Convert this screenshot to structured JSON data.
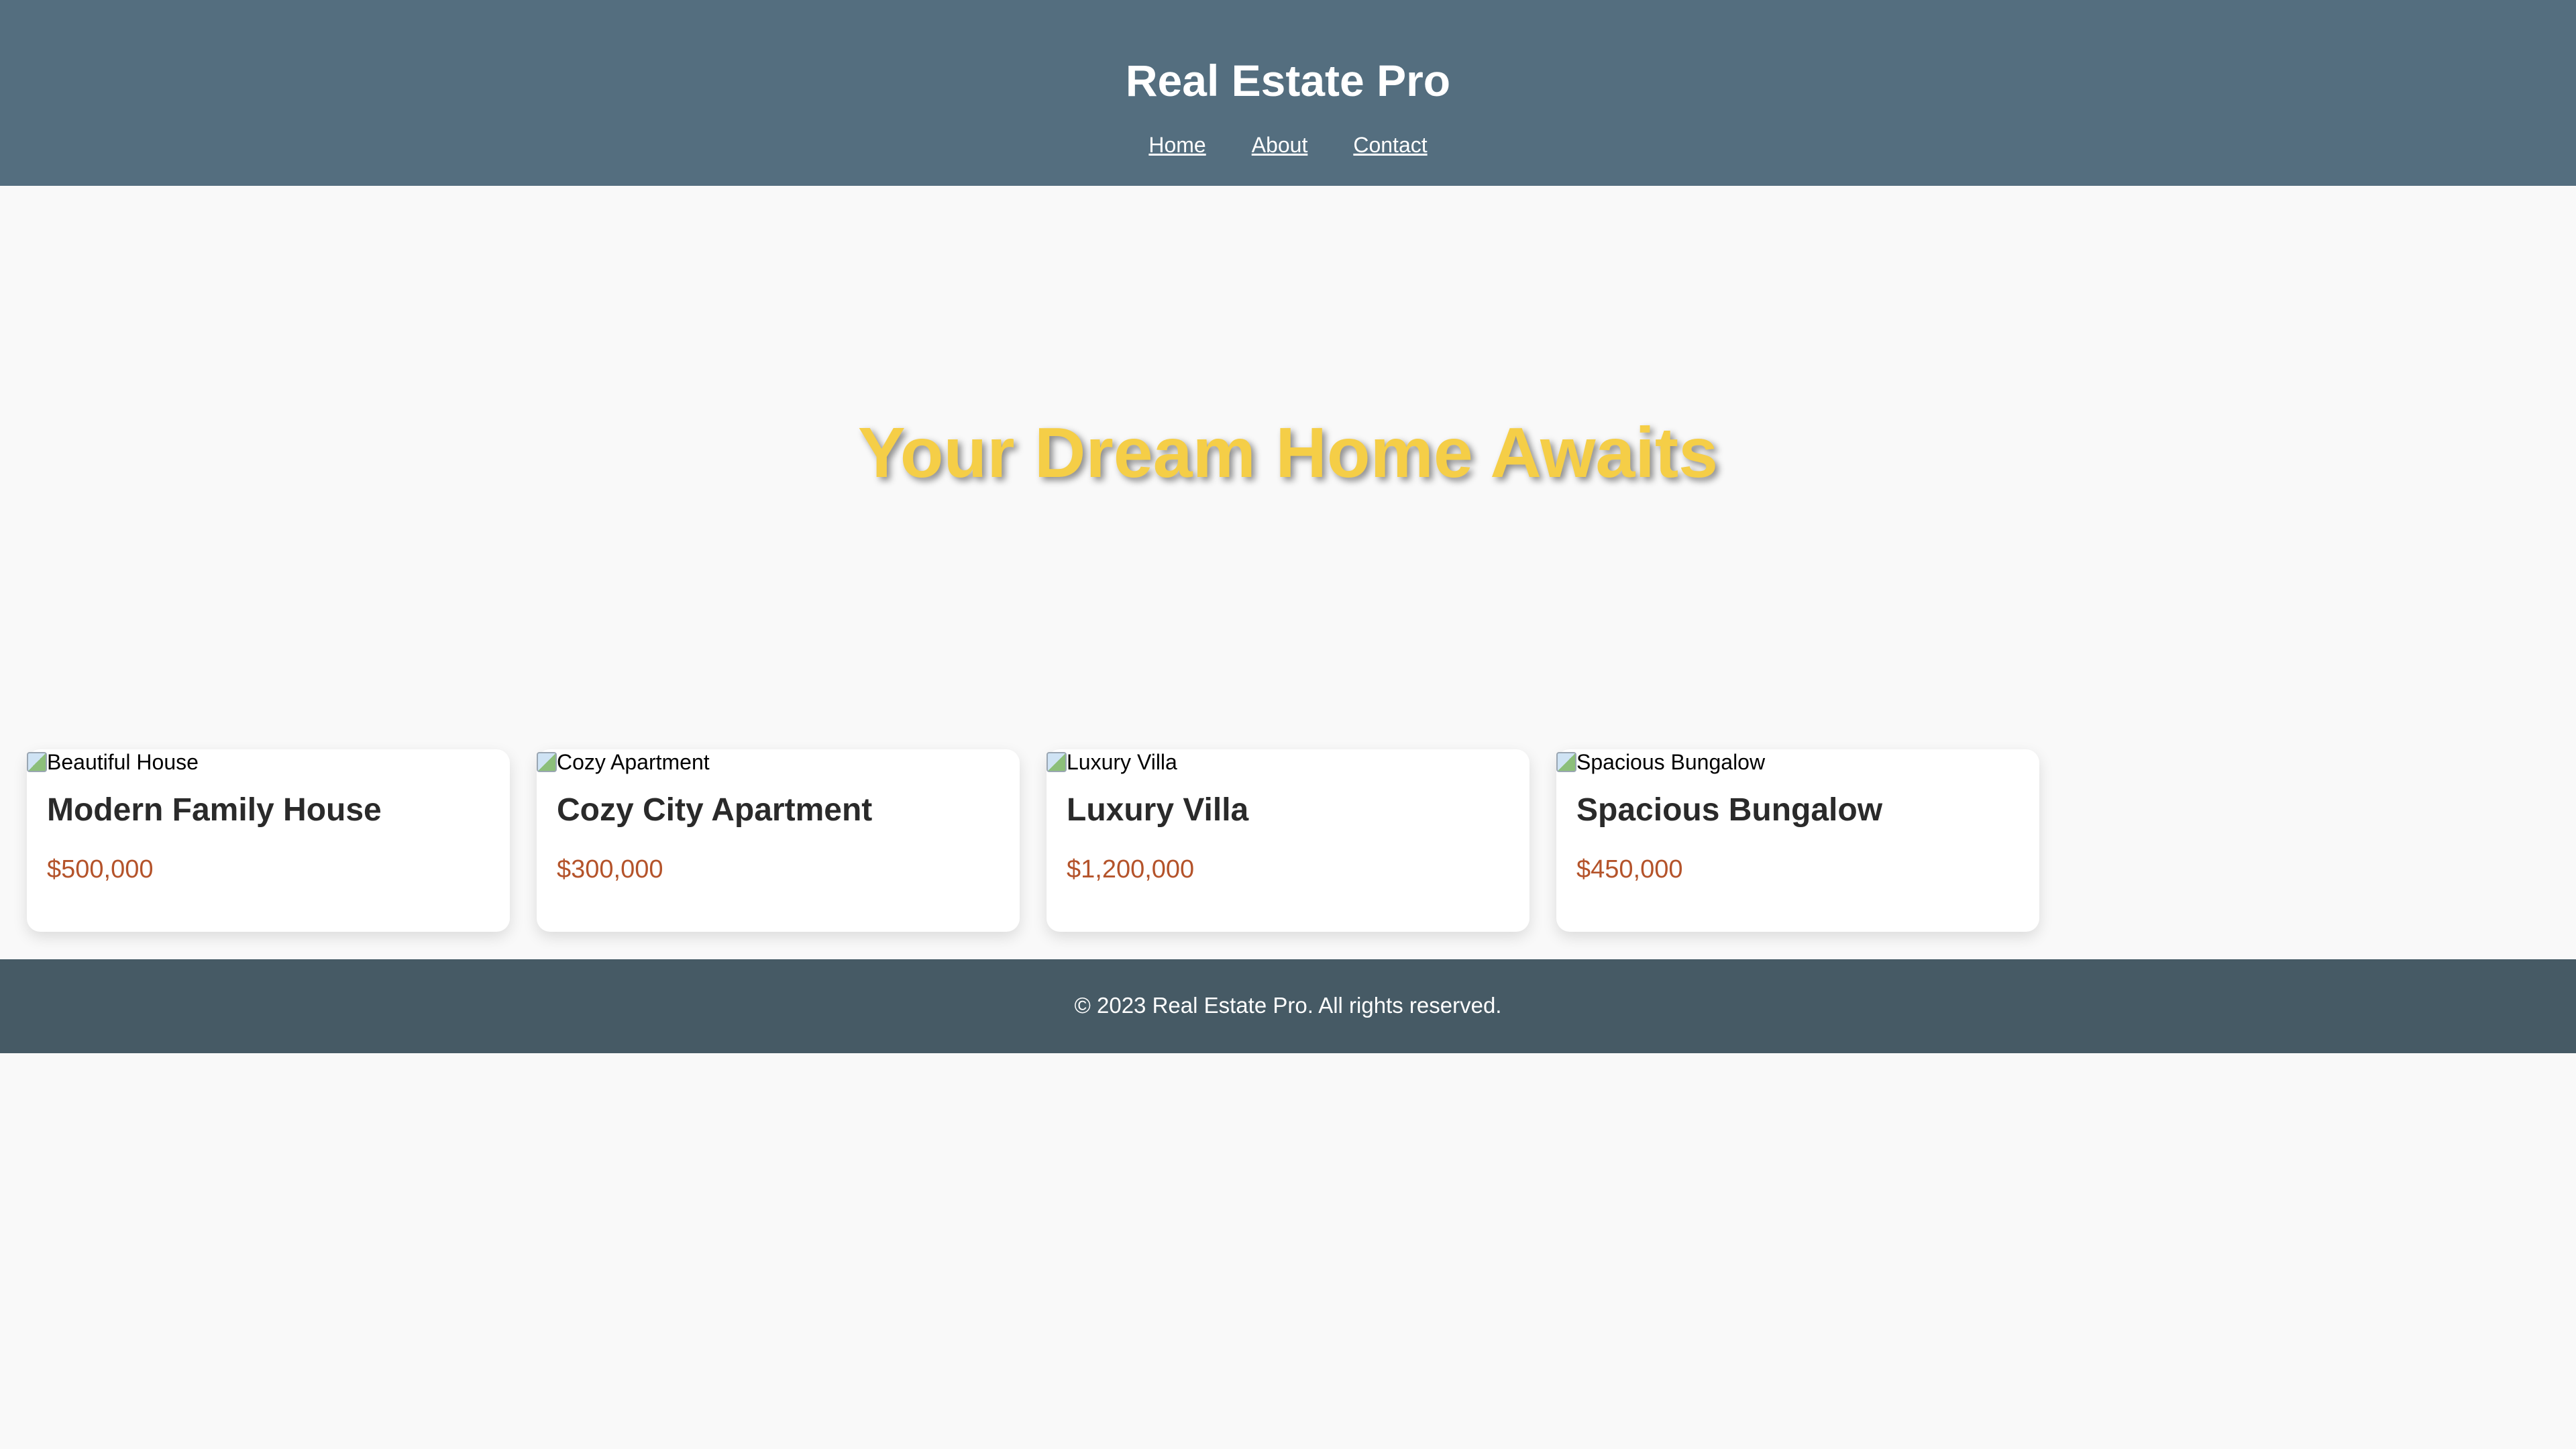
{
  "header": {
    "title": "Real Estate Pro",
    "nav": [
      {
        "label": "Home"
      },
      {
        "label": "About"
      },
      {
        "label": "Contact"
      }
    ]
  },
  "hero": {
    "title": "Your Dream Home Awaits"
  },
  "listings": [
    {
      "image_alt": "Beautiful House",
      "title": "Modern Family House",
      "price": "$500,000"
    },
    {
      "image_alt": "Cozy Apartment",
      "title": "Cozy City Apartment",
      "price": "$300,000"
    },
    {
      "image_alt": "Luxury Villa",
      "title": "Luxury Villa",
      "price": "$1,200,000"
    },
    {
      "image_alt": "Spacious Bungalow",
      "title": "Spacious Bungalow",
      "price": "$450,000"
    }
  ],
  "footer": {
    "text": "© 2023 Real Estate Pro. All rights reserved."
  },
  "colors": {
    "header_bg": "#546e7f",
    "footer_bg": "#465a65",
    "hero_text": "#f5ce47",
    "price_text": "#b4532a",
    "page_bg": "#f9f9f9"
  }
}
